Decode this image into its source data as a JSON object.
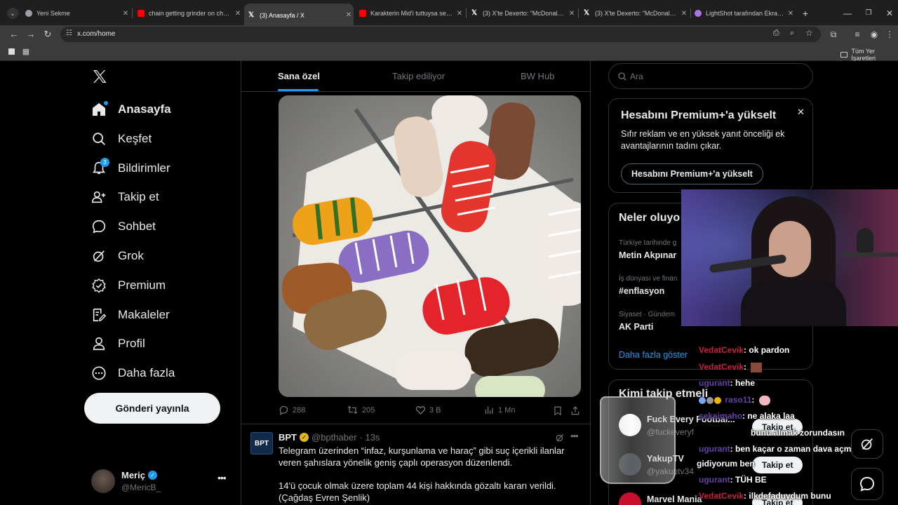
{
  "browser": {
    "tabs": [
      {
        "title": "Yeni Sekme",
        "color": "#9aa0a6"
      },
      {
        "title": "chain getting grinder on cheese",
        "color": "#ff0000"
      },
      {
        "title": "(3) Anasayfa / X",
        "color": "#ffffff"
      },
      {
        "title": "Karakterin Mid'i tuttuysa sen d...",
        "color": "#ff0000"
      },
      {
        "title": "(3) X'te Dexerto: \"McDonald's h...",
        "color": "#ffffff"
      },
      {
        "title": "(3) X'te Dexerto: \"McDonald's h...",
        "color": "#ffffff"
      },
      {
        "title": "LightShot tarafından Ekran Gör...",
        "color": "#a777e3"
      }
    ],
    "url": "x.com/home",
    "bookmarks_label": "Tüm Yer İşaretleri"
  },
  "sidebar": {
    "items": [
      {
        "label": "Anasayfa",
        "icon": "home-icon"
      },
      {
        "label": "Keşfet",
        "icon": "search-icon"
      },
      {
        "label": "Bildirimler",
        "icon": "bell-icon",
        "badge": "3"
      },
      {
        "label": "Takip et",
        "icon": "follow-icon"
      },
      {
        "label": "Sohbet",
        "icon": "chat-icon"
      },
      {
        "label": "Grok",
        "icon": "grok-icon"
      },
      {
        "label": "Premium",
        "icon": "premium-icon"
      },
      {
        "label": "Makaleler",
        "icon": "articles-icon"
      },
      {
        "label": "Profil",
        "icon": "profile-icon"
      },
      {
        "label": "Daha fazla",
        "icon": "more-icon"
      }
    ],
    "post_button": "Gönderi yayınla",
    "account": {
      "name": "Meriç",
      "handle": "@MericB_"
    }
  },
  "feed": {
    "tabs": [
      "Sana özel",
      "Takip ediliyor",
      "BW Hub"
    ],
    "actions": {
      "replies": "288",
      "reposts": "205",
      "likes": "3 B",
      "views": "1 Mn"
    },
    "post2": {
      "name": "BPT",
      "handle": "@bpthaber",
      "time": "· 13s",
      "avatar_text": "BPT",
      "text1": "Telegram üzerinden “infaz, kurşunlama ve haraç” gibi suç içerikli ilanlar veren şahıslara yönelik geniş çaplı operasyon düzenlendi.",
      "text2": "14'ü çocuk olmak üzere toplam 44 kişi hakkında gözaltı kararı verildi.",
      "text3": "(Çağdaş Evren Şenlik)"
    }
  },
  "right": {
    "search_placeholder": "Ara",
    "premium": {
      "title": "Hesabını Premium+'a yükselt",
      "desc": "Sıfır reklam ve en yüksek yanıt önceliği ek avantajlarının tadını çıkar.",
      "button": "Hesabını Premium+'a yükselt"
    },
    "trends_title": "Neler oluyo",
    "trends": [
      {
        "category": "Türkiye tarihinde g",
        "name": "Metin Akpınar"
      },
      {
        "category": "İş dünyası ve finan",
        "name": "#enflasyon"
      },
      {
        "category": "Siyaset · Gündem",
        "name": "AK Parti"
      }
    ],
    "show_more": "Daha fazla göster",
    "who_to_follow_title": "Kimi takip etmeli",
    "follow_suggestions": [
      {
        "name": "Fuck Every Footbal...",
        "handle": "@fuckeveryf",
        "button": "Takip et"
      },
      {
        "name": "YakupTV",
        "handle": "@yakuptv34",
        "button": "Takip et"
      },
      {
        "name": "Marvel Mania",
        "handle": "",
        "button": "Takip et"
      }
    ]
  },
  "stream_chat": [
    {
      "user": "VedatCevik",
      "msg": ": ok pardon"
    },
    {
      "user": "VedatCevik",
      "msg": ":"
    },
    {
      "user": "ugurant",
      "msg": ": hehe"
    },
    {
      "user": "raso11",
      "msg": ":"
    },
    {
      "user": "seksimaho",
      "msg": ": ne alaka laa"
    },
    {
      "user": "",
      "msg": "bunu almak zorundasın"
    },
    {
      "user": "ugurant",
      "msg": ": ben kaçar o zaman dava açmaya"
    },
    {
      "user": "",
      "msg": "gidiyorum ben"
    },
    {
      "user": "ugurant",
      "msg": ": TÜH BE"
    },
    {
      "user": "VedatCevik",
      "msg": ": ilkdefaduydum bunu"
    }
  ],
  "colors": {
    "accent": "#1d9bf0",
    "chat_user": "#c81f3c",
    "chat_user2": "#6441a5"
  }
}
